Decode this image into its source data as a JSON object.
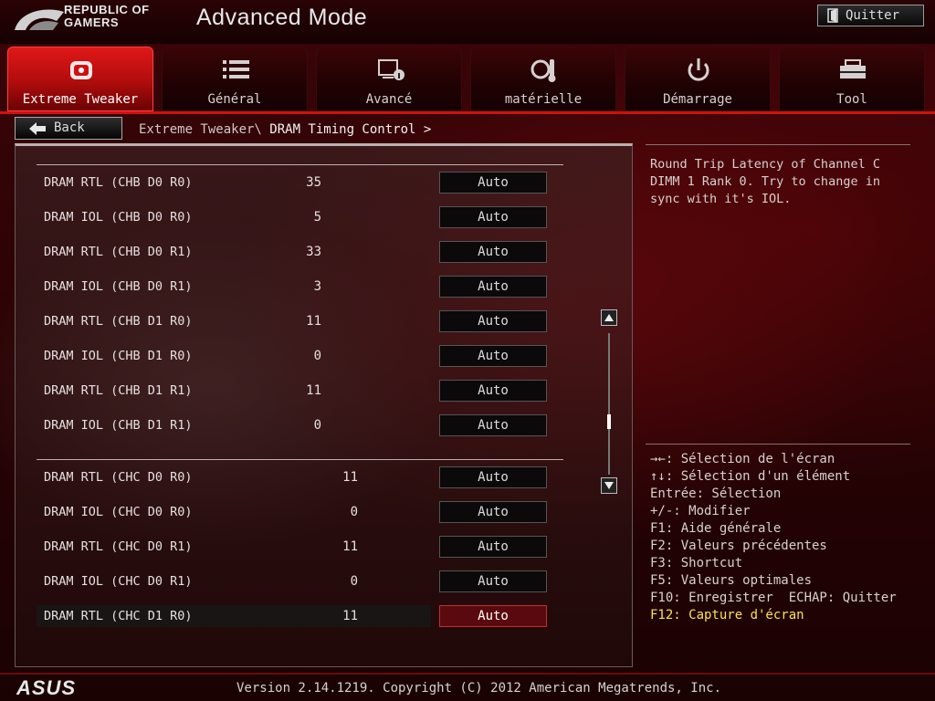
{
  "header": {
    "brand_line1": "REPUBLIC OF",
    "brand_line2": "GAMERS",
    "mode_title": "Advanced Mode",
    "quit_label": "Quitter"
  },
  "tabs": [
    {
      "label": "Extreme Tweaker",
      "icon": "tweaker-icon",
      "active": true
    },
    {
      "label": "Général",
      "icon": "list-icon",
      "active": false
    },
    {
      "label": "Avancé",
      "icon": "monitor-info-icon",
      "active": false
    },
    {
      "label": "matérielle",
      "icon": "hardware-monitor-icon",
      "active": false
    },
    {
      "label": "Démarrage",
      "icon": "power-icon",
      "active": false
    },
    {
      "label": "Tool",
      "icon": "toolbox-icon",
      "active": false
    }
  ],
  "breadcrumb": {
    "back_label": "Back",
    "path_parent": "Extreme Tweaker\\",
    "path_current": " DRAM Timing Control >"
  },
  "rows": [
    {
      "label": "DRAM RTL (CHB D0 R0)",
      "value": "35",
      "setting": "Auto"
    },
    {
      "label": "DRAM IOL (CHB D0 R0)",
      "value": "5",
      "setting": "Auto"
    },
    {
      "label": "DRAM RTL (CHB D0 R1)",
      "value": "33",
      "setting": "Auto"
    },
    {
      "label": "DRAM IOL (CHB D0 R1)",
      "value": "3",
      "setting": "Auto"
    },
    {
      "label": "DRAM RTL (CHB D1 R0)",
      "value": "11",
      "setting": "Auto"
    },
    {
      "label": "DRAM IOL (CHB D1 R0)",
      "value": "0",
      "setting": "Auto"
    },
    {
      "label": "DRAM RTL (CHB D1 R1)",
      "value": "11",
      "setting": "Auto"
    },
    {
      "label": "DRAM IOL (CHB D1 R1)",
      "value": "0",
      "setting": "Auto"
    },
    {
      "label": "DRAM RTL (CHC D0 R0)",
      "value": "11",
      "setting": "Auto"
    },
    {
      "label": "DRAM IOL (CHC D0 R0)",
      "value": "0",
      "setting": "Auto"
    },
    {
      "label": "DRAM RTL (CHC D0 R1)",
      "value": "11",
      "setting": "Auto"
    },
    {
      "label": "DRAM IOL (CHC D0 R1)",
      "value": "0",
      "setting": "Auto"
    },
    {
      "label": "DRAM RTL (CHC D1 R0)",
      "value": "11",
      "setting": "Auto",
      "selected": true
    }
  ],
  "help": {
    "description": "Round Trip Latency of Channel C DIMM 1 Rank 0. Try to change in sync with it's IOL.",
    "keys": [
      "→←: Sélection de l'écran",
      "↑↓: Sélection d'un élément",
      "Entrée: Sélection",
      "+/-: Modifier",
      "F1: Aide générale",
      "F2: Valeurs précédentes",
      "F3: Shortcut",
      "F5: Valeurs optimales",
      "F10: Enregistrer  ECHAP: Quitter"
    ],
    "highlight_key": "F12: Capture d'écran"
  },
  "footer": {
    "brand": "ASUS",
    "version": "Version 2.14.1219. Copyright (C) 2012 American Megatrends, Inc."
  },
  "colors": {
    "accent_red": "#d01010",
    "highlight_yellow": "#ffe24a",
    "selected_box": "#5a0a0e"
  }
}
